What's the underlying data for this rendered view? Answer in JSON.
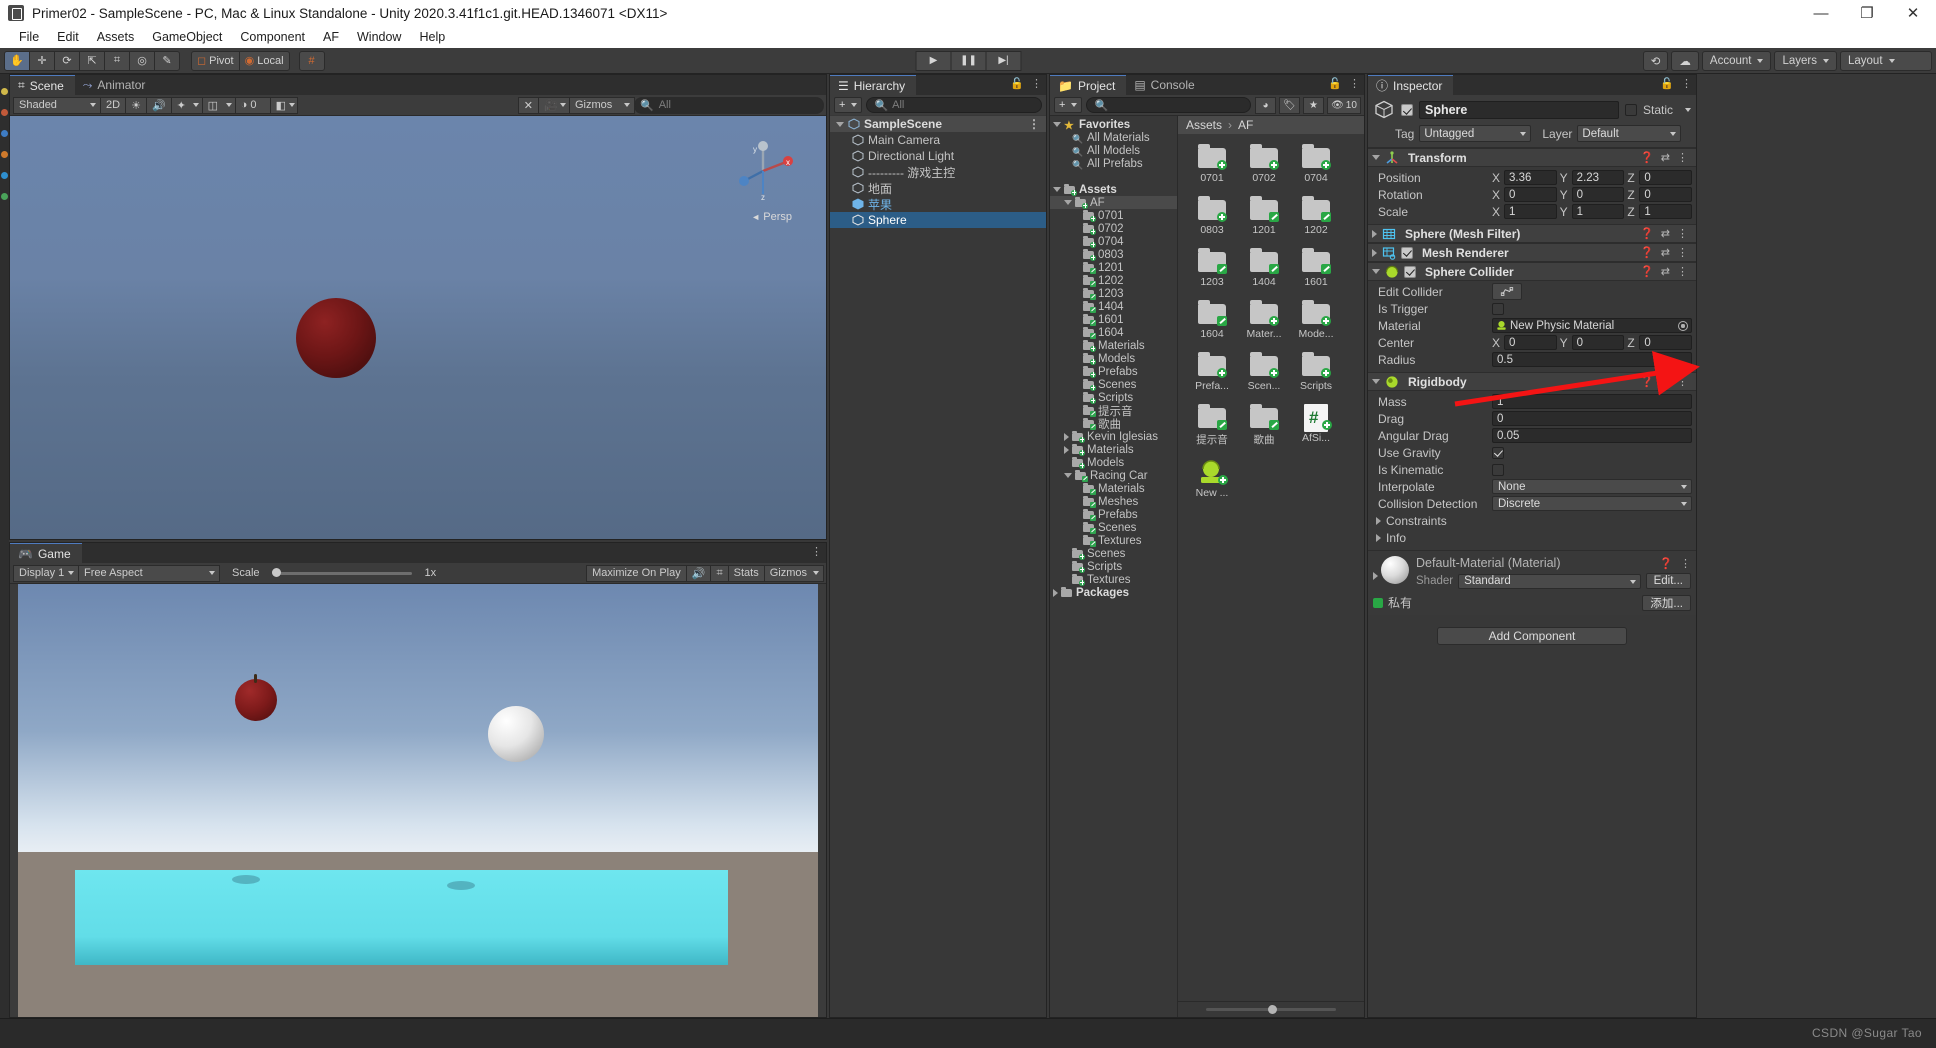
{
  "window": {
    "title": "Primer02 - SampleScene - PC, Mac & Linux Standalone - Unity 2020.3.41f1c1.git.HEAD.1346071 <DX11>",
    "minimize": "—",
    "maximize": "❐",
    "close": "✕"
  },
  "menubar": [
    "File",
    "Edit",
    "Assets",
    "GameObject",
    "Component",
    "AF",
    "Window",
    "Help"
  ],
  "toolbar": {
    "tools": [
      "hand-tool",
      "move-tool",
      "rotate-tool",
      "scale-tool",
      "rect-tool",
      "transform-tool",
      "custom-tool"
    ],
    "pivot_label": "Pivot",
    "space_label": "Local",
    "grid_label": "#",
    "play": "▶",
    "pause": "❚❚",
    "step": "▶|",
    "cloud_label": "",
    "account_label": "Account",
    "layers_label": "Layers",
    "layout_label": "Layout"
  },
  "scene": {
    "tabs": [
      {
        "label": "Scene",
        "icon": "grid-icon",
        "active": true
      },
      {
        "label": "Animator",
        "icon": "animator-icon",
        "active": false
      }
    ],
    "draw_mode": "Shaded",
    "mode_2d": "2D",
    "gizmos_label": "Gizmos",
    "search_placeholder": "All",
    "persp_label": "Persp",
    "axis_x": "x",
    "axis_y": "y",
    "axis_z": "z"
  },
  "game": {
    "tab_label": "Game",
    "display": "Display 1",
    "aspect": "Free Aspect",
    "scale_label": "Scale",
    "scale_value": "1x",
    "maximize_label": "Maximize On Play",
    "stats_label": "Stats",
    "gizmos_label": "Gizmos"
  },
  "hierarchy": {
    "tab_label": "Hierarchy",
    "add_label": "+",
    "search_placeholder": "All",
    "scene_name": "SampleScene",
    "items": [
      {
        "label": "Main Camera",
        "indent": 1,
        "type": "gameobject"
      },
      {
        "label": "Directional Light",
        "indent": 1,
        "type": "gameobject"
      },
      {
        "label": "--------- 游戏主控",
        "indent": 1,
        "type": "gameobject"
      },
      {
        "label": "地面",
        "indent": 1,
        "type": "gameobject"
      },
      {
        "label": "苹果",
        "indent": 1,
        "type": "prefab"
      },
      {
        "label": "Sphere",
        "indent": 1,
        "type": "gameobject",
        "selected": true
      }
    ]
  },
  "project": {
    "tabs": [
      {
        "label": "Project",
        "icon": "folder-icon",
        "active": true
      },
      {
        "label": "Console",
        "icon": "console-icon",
        "active": false
      }
    ],
    "add_label": "+",
    "search_placeholder": "",
    "hidden_count": "10",
    "breadcrumb": [
      "Assets",
      "AF"
    ],
    "tree": [
      {
        "label": "Favorites",
        "indent": 0,
        "icon": "star",
        "bold": true,
        "arrow": "open"
      },
      {
        "label": "All Materials",
        "indent": 1,
        "icon": "search"
      },
      {
        "label": "All Models",
        "indent": 1,
        "icon": "search"
      },
      {
        "label": "All Prefabs",
        "indent": 1,
        "icon": "search"
      },
      {
        "label": "",
        "indent": 0,
        "icon": "none"
      },
      {
        "label": "Assets",
        "indent": 0,
        "icon": "folder-plus",
        "bold": true,
        "arrow": "open"
      },
      {
        "label": "AF",
        "indent": 1,
        "icon": "folder-plus",
        "arrow": "open",
        "highlight": true
      },
      {
        "label": "0701",
        "indent": 2,
        "icon": "folder-plus"
      },
      {
        "label": "0702",
        "indent": 2,
        "icon": "folder-plus"
      },
      {
        "label": "0704",
        "indent": 2,
        "icon": "folder-plus"
      },
      {
        "label": "0803",
        "indent": 2,
        "icon": "folder-plus"
      },
      {
        "label": "1201",
        "indent": 2,
        "icon": "folder-pen"
      },
      {
        "label": "1202",
        "indent": 2,
        "icon": "folder-pen"
      },
      {
        "label": "1203",
        "indent": 2,
        "icon": "folder-pen"
      },
      {
        "label": "1404",
        "indent": 2,
        "icon": "folder-pen"
      },
      {
        "label": "1601",
        "indent": 2,
        "icon": "folder-pen"
      },
      {
        "label": "1604",
        "indent": 2,
        "icon": "folder-pen"
      },
      {
        "label": "Materials",
        "indent": 2,
        "icon": "folder-plus"
      },
      {
        "label": "Models",
        "indent": 2,
        "icon": "folder-plus"
      },
      {
        "label": "Prefabs",
        "indent": 2,
        "icon": "folder-plus"
      },
      {
        "label": "Scenes",
        "indent": 2,
        "icon": "folder-plus"
      },
      {
        "label": "Scripts",
        "indent": 2,
        "icon": "folder-plus"
      },
      {
        "label": "提示音",
        "indent": 2,
        "icon": "folder-pen"
      },
      {
        "label": "歌曲",
        "indent": 2,
        "icon": "folder-pen"
      },
      {
        "label": "Kevin Iglesias",
        "indent": 1,
        "icon": "folder-plus",
        "arrow": "closed"
      },
      {
        "label": "Materials",
        "indent": 1,
        "icon": "folder-plus",
        "arrow": "closed"
      },
      {
        "label": "Models",
        "indent": 1,
        "icon": "folder-plus"
      },
      {
        "label": "Racing Car",
        "indent": 1,
        "icon": "folder-pen",
        "arrow": "open"
      },
      {
        "label": "Materials",
        "indent": 2,
        "icon": "folder-pen"
      },
      {
        "label": "Meshes",
        "indent": 2,
        "icon": "folder-pen"
      },
      {
        "label": "Prefabs",
        "indent": 2,
        "icon": "folder-pen"
      },
      {
        "label": "Scenes",
        "indent": 2,
        "icon": "folder-pen"
      },
      {
        "label": "Textures",
        "indent": 2,
        "icon": "folder-pen"
      },
      {
        "label": "Scenes",
        "indent": 1,
        "icon": "folder-plus"
      },
      {
        "label": "Scripts",
        "indent": 1,
        "icon": "folder-plus-outline"
      },
      {
        "label": "Textures",
        "indent": 1,
        "icon": "folder-plus"
      },
      {
        "label": "Packages",
        "indent": 0,
        "icon": "folder",
        "bold": true,
        "arrow": "closed"
      }
    ],
    "grid": [
      {
        "label": "0701",
        "icon": "folder",
        "badge": "plus"
      },
      {
        "label": "0702",
        "icon": "folder",
        "badge": "plus"
      },
      {
        "label": "0704",
        "icon": "folder",
        "badge": "plus"
      },
      {
        "label": "0803",
        "icon": "folder",
        "badge": "plus"
      },
      {
        "label": "1201",
        "icon": "folder",
        "badge": "pen"
      },
      {
        "label": "1202",
        "icon": "folder",
        "badge": "pen"
      },
      {
        "label": "1203",
        "icon": "folder",
        "badge": "pen"
      },
      {
        "label": "1404",
        "icon": "folder",
        "badge": "pen"
      },
      {
        "label": "1601",
        "icon": "folder",
        "badge": "pen"
      },
      {
        "label": "1604",
        "icon": "folder",
        "badge": "pen"
      },
      {
        "label": "Mater...",
        "icon": "folder",
        "badge": "plus"
      },
      {
        "label": "Mode...",
        "icon": "folder",
        "badge": "plus"
      },
      {
        "label": "Prefa...",
        "icon": "folder",
        "badge": "plus"
      },
      {
        "label": "Scen...",
        "icon": "folder",
        "badge": "plus"
      },
      {
        "label": "Scripts",
        "icon": "folder",
        "badge": "plus"
      },
      {
        "label": "提示音",
        "icon": "folder",
        "badge": "pen"
      },
      {
        "label": "歌曲",
        "icon": "folder",
        "badge": "pen"
      },
      {
        "label": "AfSi...",
        "icon": "csharp-script",
        "badge": "plus"
      },
      {
        "label": "New ...",
        "icon": "physic-material",
        "badge": "plus"
      }
    ]
  },
  "inspector": {
    "tab_label": "Inspector",
    "object_name": "Sphere",
    "enabled": true,
    "static_label": "Static",
    "tag_label": "Tag",
    "tag_value": "Untagged",
    "layer_label": "Layer",
    "layer_value": "Default",
    "components": [
      {
        "name": "Transform",
        "icon": "transform-icon",
        "expanded": true,
        "has_checkbox": false,
        "rows": [
          {
            "label": "Position",
            "type": "vector3",
            "x": "3.36",
            "y": "2.23",
            "z": "0"
          },
          {
            "label": "Rotation",
            "type": "vector3",
            "x": "0",
            "y": "0",
            "z": "0"
          },
          {
            "label": "Scale",
            "type": "vector3",
            "x": "1",
            "y": "1",
            "z": "1"
          }
        ]
      },
      {
        "name": "Sphere (Mesh Filter)",
        "icon": "mesh-filter-icon",
        "expanded": false,
        "has_checkbox": false,
        "rows": []
      },
      {
        "name": "Mesh Renderer",
        "icon": "mesh-renderer-icon",
        "expanded": false,
        "has_checkbox": true,
        "checked": true,
        "rows": []
      },
      {
        "name": "Sphere Collider",
        "icon": "sphere-collider-icon",
        "expanded": true,
        "has_checkbox": true,
        "checked": true,
        "rows": [
          {
            "label": "Edit Collider",
            "type": "editbutton"
          },
          {
            "label": "Is Trigger",
            "type": "checkbox",
            "checked": false
          },
          {
            "label": "Material",
            "type": "object",
            "value": "New Physic Material"
          },
          {
            "label": "Center",
            "type": "vector3",
            "x": "0",
            "y": "0",
            "z": "0"
          },
          {
            "label": "Radius",
            "type": "text",
            "value": "0.5"
          }
        ]
      },
      {
        "name": "Rigidbody",
        "icon": "rigidbody-icon",
        "expanded": true,
        "has_checkbox": false,
        "rows": [
          {
            "label": "Mass",
            "type": "text",
            "value": "1"
          },
          {
            "label": "Drag",
            "type": "text",
            "value": "0"
          },
          {
            "label": "Angular Drag",
            "type": "text",
            "value": "0.05"
          },
          {
            "label": "Use Gravity",
            "type": "checkbox",
            "checked": true
          },
          {
            "label": "Is Kinematic",
            "type": "checkbox",
            "checked": false
          },
          {
            "label": "Interpolate",
            "type": "dropdown",
            "value": "None"
          },
          {
            "label": "Collision Detection",
            "type": "dropdown",
            "value": "Discrete"
          },
          {
            "label": "Constraints",
            "type": "foldout"
          },
          {
            "label": "Info",
            "type": "foldout"
          }
        ]
      }
    ],
    "material_preview": {
      "title": "Default-Material (Material)",
      "shader_label": "Shader",
      "shader_value": "Standard",
      "edit_label": "Edit...",
      "private_label": "私有",
      "add_label": "添加..."
    },
    "add_component_label": "Add Component"
  },
  "watermark": "CSDN @Sugar Tao",
  "colors": {
    "accent_blue": "#2c5d87",
    "tab_accent": "#4f7bbf",
    "green_badge": "#29a745",
    "arrow_red": "#f41414",
    "panel_bg": "#383838",
    "header_bg": "#3c3c3c"
  }
}
